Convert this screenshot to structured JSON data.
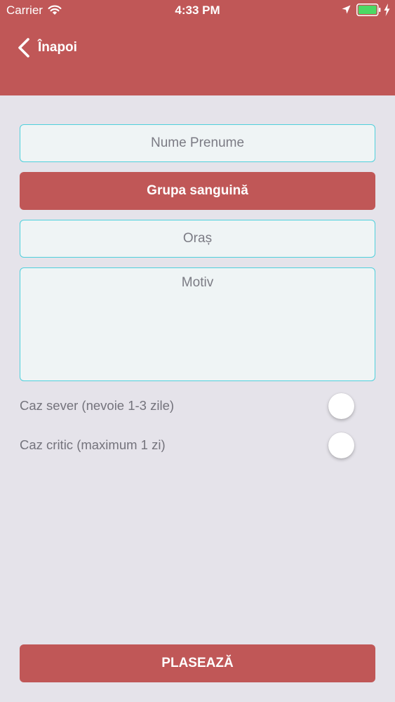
{
  "status_bar": {
    "carrier": "Carrier",
    "time": "4:33 PM",
    "battery_color": "#4cd964"
  },
  "header": {
    "back_label": "Înapoi",
    "background_color": "#c05757"
  },
  "form": {
    "name_placeholder": "Nume Prenume",
    "blood_group_label": "Grupa sanguină",
    "city_placeholder": "Oraș",
    "reason_placeholder": "Motiv",
    "field_border_color": "#4fd0dc"
  },
  "toggles": [
    {
      "label": "Caz sever (nevoie 1-3 zile)",
      "on": false
    },
    {
      "label": "Caz critic (maximum 1 zi)",
      "on": false
    }
  ],
  "submit": {
    "label": "PLASEAZĂ"
  },
  "icons": {
    "wifi": "wifi-icon",
    "location": "location-arrow-icon",
    "battery": "battery-icon",
    "charging": "bolt-icon",
    "back": "chevron-left-icon"
  }
}
